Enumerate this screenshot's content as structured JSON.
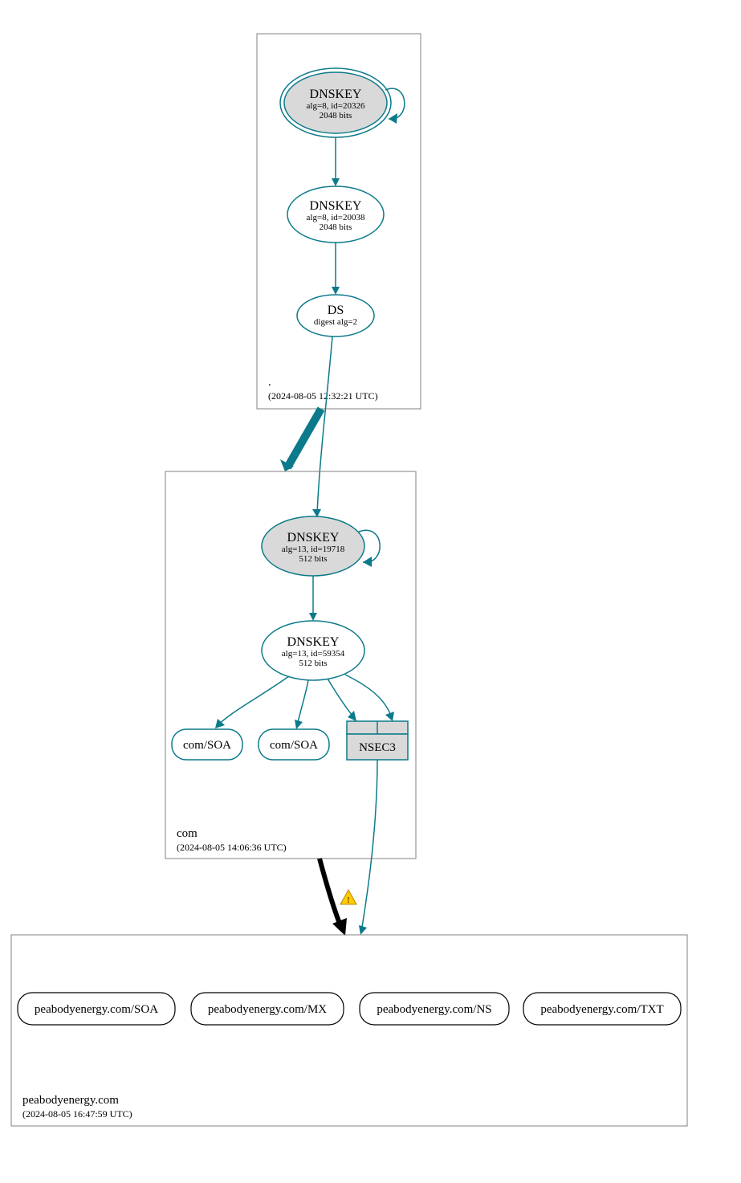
{
  "zones": {
    "root": {
      "name": ".",
      "timestamp": "(2024-08-05 12:32:21 UTC)"
    },
    "com": {
      "name": "com",
      "timestamp": "(2024-08-05 14:06:36 UTC)"
    },
    "domain": {
      "name": "peabodyenergy.com",
      "timestamp": "(2024-08-05 16:47:59 UTC)"
    }
  },
  "nodes": {
    "root_ksk": {
      "title": "DNSKEY",
      "line1": "alg=8, id=20326",
      "line2": "2048 bits"
    },
    "root_zsk": {
      "title": "DNSKEY",
      "line1": "alg=8, id=20038",
      "line2": "2048 bits"
    },
    "root_ds": {
      "title": "DS",
      "line1": "digest alg=2"
    },
    "com_ksk": {
      "title": "DNSKEY",
      "line1": "alg=13, id=19718",
      "line2": "512 bits"
    },
    "com_zsk": {
      "title": "DNSKEY",
      "line1": "alg=13, id=59354",
      "line2": "512 bits"
    },
    "com_soa1": {
      "label": "com/SOA"
    },
    "com_soa2": {
      "label": "com/SOA"
    },
    "com_nsec3": {
      "label": "NSEC3"
    },
    "d_soa": {
      "label": "peabodyenergy.com/SOA"
    },
    "d_mx": {
      "label": "peabodyenergy.com/MX"
    },
    "d_ns": {
      "label": "peabodyenergy.com/NS"
    },
    "d_txt": {
      "label": "peabodyenergy.com/TXT"
    }
  },
  "icons": {
    "warning": "!"
  }
}
